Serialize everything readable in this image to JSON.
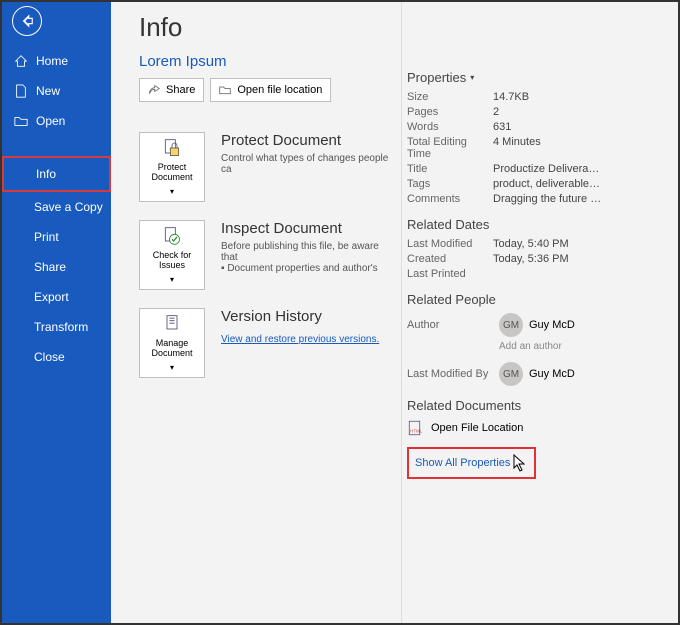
{
  "sidebar": {
    "items": [
      {
        "label": "Home"
      },
      {
        "label": "New"
      },
      {
        "label": "Open"
      },
      {
        "label": "Info"
      },
      {
        "label": "Save a Copy"
      },
      {
        "label": "Print"
      },
      {
        "label": "Share"
      },
      {
        "label": "Export"
      },
      {
        "label": "Transform"
      },
      {
        "label": "Close"
      }
    ]
  },
  "page": {
    "title": "Info",
    "docName": "Lorem Ipsum"
  },
  "toolbar": {
    "share": "Share",
    "openLocation": "Open file location"
  },
  "sections": {
    "protect": {
      "card": "Protect Document",
      "title": "Protect Document",
      "desc": "Control what types of changes people ca"
    },
    "inspect": {
      "card": "Check for Issues",
      "title": "Inspect Document",
      "desc1": "Before publishing this file, be aware that",
      "desc2": "Document properties and author's"
    },
    "version": {
      "card": "Manage Document",
      "title": "Version History",
      "link": "View and restore previous versions."
    }
  },
  "props": {
    "header": "Properties",
    "rows": [
      {
        "label": "Size",
        "value": "14.7KB"
      },
      {
        "label": "Pages",
        "value": "2"
      },
      {
        "label": "Words",
        "value": "631"
      },
      {
        "label": "Total Editing Time",
        "value": "4 Minutes"
      },
      {
        "label": "Title",
        "value": "Productize Deliverables"
      },
      {
        "label": "Tags",
        "value": "product, deliverables, opti…"
      },
      {
        "label": "Comments",
        "value": "Dragging the future into n…"
      }
    ]
  },
  "dates": {
    "header": "Related Dates",
    "rows": [
      {
        "label": "Last Modified",
        "value": "Today, 5:40 PM"
      },
      {
        "label": "Created",
        "value": "Today, 5:36 PM"
      },
      {
        "label": "Last Printed",
        "value": ""
      }
    ]
  },
  "people": {
    "header": "Related People",
    "authorLabel": "Author",
    "author": {
      "initials": "GM",
      "name": "Guy McD"
    },
    "addAuthor": "Add an author",
    "lastModLabel": "Last Modified By",
    "lastMod": {
      "initials": "GM",
      "name": "Guy McD"
    }
  },
  "docs": {
    "header": "Related Documents",
    "openLocation": "Open File Location",
    "showAll": "Show All Properties"
  }
}
